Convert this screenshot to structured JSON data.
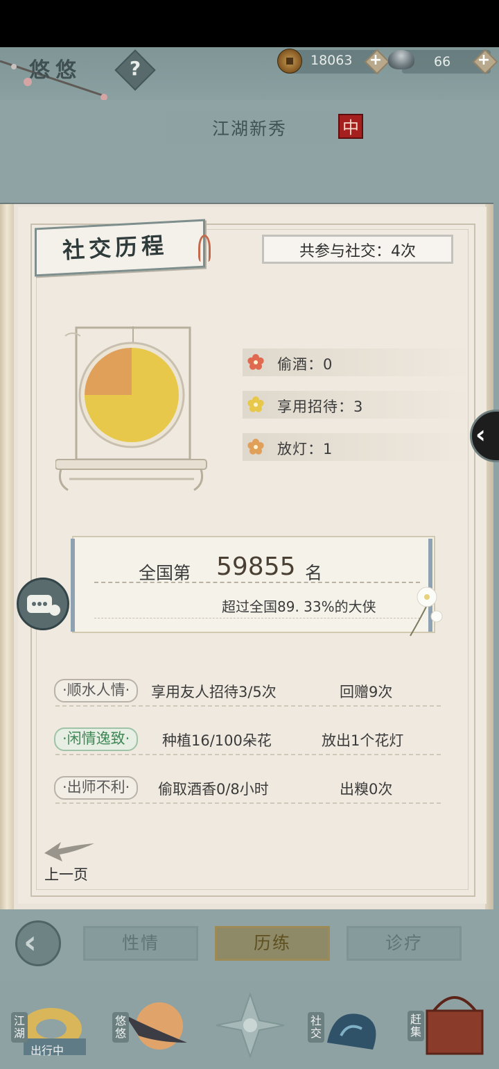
{
  "header": {
    "character_name": "悠悠",
    "help_label": "?",
    "coins": "18063",
    "silver": "66",
    "plus_label": "+"
  },
  "title": {
    "rank_title": "江湖新秀",
    "seal_char": "中"
  },
  "social": {
    "section_title": "社交历程",
    "total_label": "共参与社交：4次"
  },
  "chart_data": {
    "type": "pie",
    "categories": [
      "偷酒",
      "享用招待",
      "放灯"
    ],
    "values": [
      0,
      3,
      1
    ],
    "colors": [
      "#e06a4f",
      "#e8c84a",
      "#e0a05a"
    ]
  },
  "legend": [
    {
      "label": "偷酒：0",
      "color": "#e06a4f"
    },
    {
      "label": "享用招待：3",
      "color": "#e8c84a"
    },
    {
      "label": "放灯：1",
      "color": "#e0a05a"
    }
  ],
  "rank": {
    "prefix": "全国第",
    "number": "59855",
    "suffix": "名",
    "subtext": "超过全国89. 33%的大侠"
  },
  "achievements": [
    {
      "tag": "·顺水人情·",
      "c1": "享用友人招待3/5次",
      "c2": "回赠9次",
      "active": false
    },
    {
      "tag": "·闲情逸致·",
      "c1": "种植16/100朵花",
      "c2": "放出1个花灯",
      "active": true
    },
    {
      "tag": "·出师不利·",
      "c1": "偷取酒香0/8小时",
      "c2": "出糗0次",
      "active": false
    }
  ],
  "prev_page_label": "上一页",
  "tabs": [
    {
      "label": "性情",
      "active": false
    },
    {
      "label": "历练",
      "active": true
    },
    {
      "label": "诊疗",
      "active": false
    }
  ],
  "nav": [
    {
      "label": "江湖",
      "sub": "出行中"
    },
    {
      "label": "悠悠"
    },
    {
      "label": ""
    },
    {
      "label": "社交"
    },
    {
      "label": "赶集"
    }
  ]
}
